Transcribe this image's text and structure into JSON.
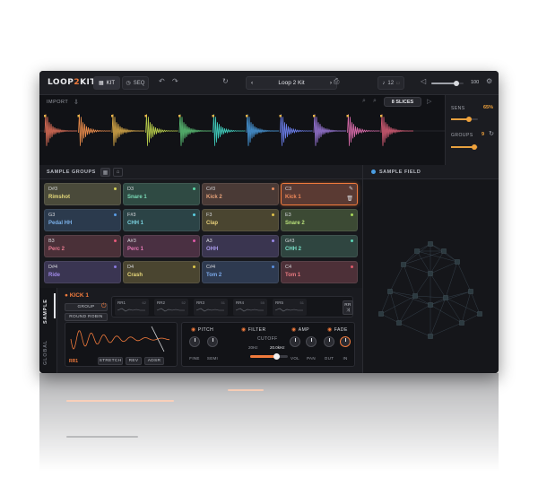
{
  "app": {
    "logo_prefix": "LOOP",
    "logo_mid": "2",
    "logo_suffix": "KIT",
    "tab_kit": "KIT",
    "tab_seq": "SEQ",
    "kit_name": "Loop 2 Kit",
    "tempo": "12",
    "tempo_unit": "☐",
    "volume_value": "100",
    "volume_level": 0.78
  },
  "waveform": {
    "import_label": "IMPORT",
    "slices_label": "8 SLICES",
    "slice_colors": [
      "#e8735a",
      "#e78a4a",
      "#e3b14a",
      "#b4c94a",
      "#5fc97a",
      "#3fc9b9",
      "#4a9ee3",
      "#6a7de8",
      "#a07be0",
      "#d66aa8",
      "#e0607a"
    ]
  },
  "side_panel": {
    "sens_label": "SENS",
    "sens_value": "65%",
    "sens_level": 0.65,
    "groups_label": "GROUPS",
    "groups_value": "9",
    "groups_level": 0.85
  },
  "groups": {
    "title": "SAMPLE GROUPS",
    "pads": [
      {
        "note": "D#3",
        "name": "Rimshot",
        "bg": "#4a4a3a",
        "color": "#e3d77a",
        "dot": "#d8d45a"
      },
      {
        "note": "D3",
        "name": "Snare 1",
        "bg": "#2f4a43",
        "color": "#7ad9b6",
        "dot": "#5ad9a8"
      },
      {
        "note": "C#3",
        "name": "Kick 2",
        "bg": "#4a3a36",
        "color": "#e8a37a",
        "dot": "#e88a5a"
      },
      {
        "note": "C3",
        "name": "Kick 1",
        "bg": "#5a3a33",
        "color": "#f0895a",
        "dot": "#f07a3c",
        "selected": true
      },
      {
        "note": "G3",
        "name": "Pedal HH",
        "bg": "#2b3a4d",
        "color": "#7ab0e8",
        "dot": "#5a9ee8"
      },
      {
        "note": "F#3",
        "name": "CHH 1",
        "bg": "#2b4346",
        "color": "#7ad3e0",
        "dot": "#5acde0"
      },
      {
        "note": "F3",
        "name": "Clap",
        "bg": "#4a4530",
        "color": "#e8d07a",
        "dot": "#e0c24a"
      },
      {
        "note": "E3",
        "name": "Snare 2",
        "bg": "#3c4a34",
        "color": "#b8e07a",
        "dot": "#a8d85a"
      },
      {
        "note": "B3",
        "name": "Perc 2",
        "bg": "#4a3038",
        "color": "#e87a90",
        "dot": "#e85a7a"
      },
      {
        "note": "A#3",
        "name": "Perc 1",
        "bg": "#4a3042",
        "color": "#e87ab8",
        "dot": "#e05aa8"
      },
      {
        "note": "A3",
        "name": "OHH",
        "bg": "#3a3550",
        "color": "#a89ae8",
        "dot": "#9a8ae8"
      },
      {
        "note": "G#3",
        "name": "CHH 2",
        "bg": "#2f4540",
        "color": "#7ae0c8",
        "dot": "#5ad8b8"
      },
      {
        "note": "D#4",
        "name": "Ride",
        "bg": "#3a3552",
        "color": "#a08ae8",
        "dot": "#8a7ae0"
      },
      {
        "note": "D4",
        "name": "Crash",
        "bg": "#4a4530",
        "color": "#e8d87a",
        "dot": "#e0c84a"
      },
      {
        "note": "C#4",
        "name": "Tom 2",
        "bg": "#2e3a50",
        "color": "#7aa8e8",
        "dot": "#5a90e0"
      },
      {
        "note": "C4",
        "name": "Tom 1",
        "bg": "#4d3038",
        "color": "#e87a80",
        "dot": "#e05a6a"
      }
    ]
  },
  "field": {
    "title": "SAMPLE FIELD"
  },
  "editor": {
    "tab_sample": "SAMPLE",
    "tab_global": "GLOBAL",
    "sample_name": "KICK 1",
    "group_label": "GROUP",
    "round_robin_label": "ROUND ROBIN",
    "round_robins": [
      {
        "name": "RR1",
        "num": "62"
      },
      {
        "name": "RR2",
        "num": "52"
      },
      {
        "name": "RR3",
        "num": "51"
      },
      {
        "name": "RR4",
        "num": "55"
      },
      {
        "name": "RR5",
        "num": "51"
      }
    ],
    "rr_short": "RR",
    "rr_selected": "RR1",
    "stretch_label": "STRETCH",
    "rev_label": "REV",
    "adsr_label": "ADSR",
    "pitch_title": "PITCH",
    "fine_label": "FINE",
    "semi_label": "SEMI",
    "filter_title": "FILTER",
    "cutoff_label": "CUTOFF",
    "cutoff_min": "20Hz",
    "cutoff_max": "20.0kHz",
    "cutoff_level": 0.7,
    "amp_title": "AMP",
    "vol_label": "VOL",
    "pan_label": "PAN",
    "fade_title": "FADE",
    "out_label": "OUT",
    "in_label": "IN"
  }
}
